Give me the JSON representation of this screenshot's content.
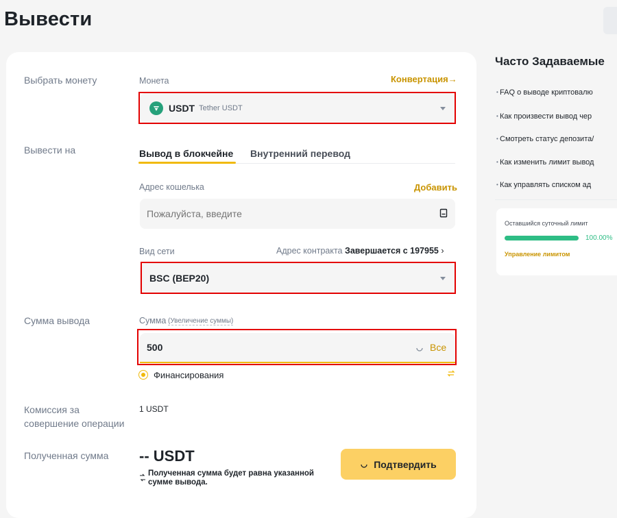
{
  "page": {
    "title": "Вывести"
  },
  "coin": {
    "row_label": "Выбрать монету",
    "field_label": "Монета",
    "convert_link": "Конвертация",
    "selected_symbol": "USDT",
    "selected_name": "Tether USDT"
  },
  "destination": {
    "row_label": "Вывести на",
    "tabs": [
      {
        "label": "Вывод в блокчейне",
        "active": true
      },
      {
        "label": "Внутренний перевод",
        "active": false
      }
    ],
    "wallet_label": "Адрес кошелька",
    "add_link": "Добавить",
    "address_placeholder": "Пожалуйста, введите",
    "network_label": "Вид сети",
    "contract_label": "Адрес контракта",
    "contract_value": "Завершается с 197955",
    "network_value": "BSC (BEP20)"
  },
  "amount": {
    "row_label": "Сумма вывода",
    "field_label": "Сумма",
    "increase_link": "(Увеличение суммы)",
    "value": "500",
    "all_button": "Все",
    "funding_label": "Финансирования"
  },
  "fee": {
    "row_label_line1": "Комиссия за",
    "row_label_line2": "совершение операции",
    "value": "1 USDT"
  },
  "received": {
    "row_label": "Полученная сумма",
    "value": "-- USDT",
    "note_line1": "Полученная сумма будет равна указанной",
    "note_line2": "сумме вывода.",
    "confirm_button": "Подтвердить"
  },
  "sidebar": {
    "title": "Часто Задаваемые",
    "faq": [
      "FAQ о выводе криптовалю",
      "Как произвести вывод чер",
      "Смотреть статус депозита/",
      "Как изменить лимит вывод",
      "Как управлять списком ад"
    ],
    "limit": {
      "label": "Оставшийся суточный лимит",
      "percent_text": "100.00%",
      "fraction": 1.0,
      "manage_link": "Управление лимитом"
    }
  },
  "colors": {
    "accent": "#f0b90b",
    "link_gold": "#c99400",
    "highlight_red": "#e30000",
    "success_green": "#2ebd85",
    "tether_green": "#26a17b"
  }
}
